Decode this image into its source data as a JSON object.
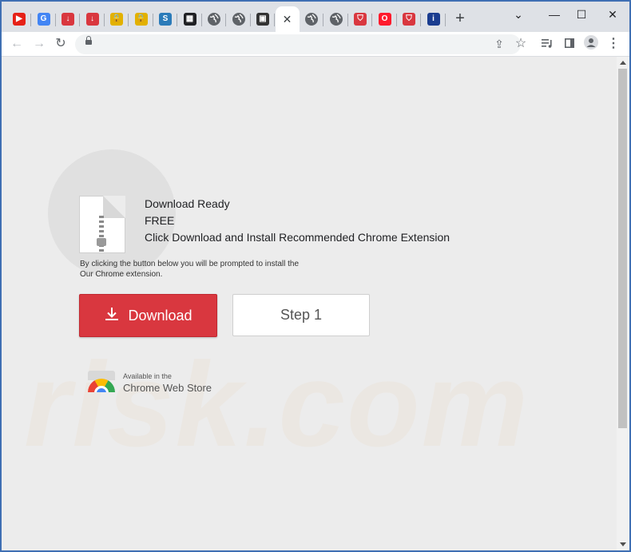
{
  "tabs": [
    {
      "icon": "youtube-icon",
      "glyph": "▶",
      "color": "#e62117"
    },
    {
      "icon": "google-icon",
      "glyph": "G",
      "color": "#4285f4"
    },
    {
      "icon": "download-arrow-icon",
      "glyph": "↓",
      "color": "#d9373f"
    },
    {
      "icon": "download-arrow-icon",
      "glyph": "↓",
      "color": "#d9373f"
    },
    {
      "icon": "lock-icon",
      "glyph": "🔒",
      "color": "#e2b100"
    },
    {
      "icon": "lock-icon",
      "glyph": "🔒",
      "color": "#e2b100"
    },
    {
      "icon": "s-logo-icon",
      "glyph": "S",
      "color": "#2b7bb9"
    },
    {
      "icon": "dark-logo-icon",
      "glyph": "▦",
      "color": "#202124"
    },
    {
      "icon": "globe-icon",
      "glyph": "",
      "color": "#5f6368"
    },
    {
      "icon": "globe-icon",
      "glyph": "",
      "color": "#5f6368"
    },
    {
      "icon": "image-icon",
      "glyph": "▣",
      "color": "#333333"
    },
    {
      "icon": "close-icon",
      "glyph": "✕",
      "color": "#3c4043",
      "active": true
    },
    {
      "icon": "globe-icon",
      "glyph": "",
      "color": "#5f6368"
    },
    {
      "icon": "globe-icon",
      "glyph": "",
      "color": "#5f6368"
    },
    {
      "icon": "shield-icon",
      "glyph": "⛉",
      "color": "#d9373f"
    },
    {
      "icon": "opera-icon",
      "glyph": "O",
      "color": "#ff1b2d"
    },
    {
      "icon": "shield-icon",
      "glyph": "⛉",
      "color": "#d9373f"
    },
    {
      "icon": "italic-i-icon",
      "glyph": "i",
      "color": "#1a3c8f"
    }
  ],
  "window": {
    "minimize": "—",
    "maximize": "☐",
    "close": "✕",
    "dropdown": "⌄",
    "new_tab": "+"
  },
  "toolbar": {
    "back": "←",
    "forward": "→",
    "reload": "↻",
    "share": "⇪",
    "star": "☆",
    "menu": "⋮"
  },
  "content": {
    "line1": "Download Ready",
    "line2": "FREE",
    "line3": "Click Download and Install Recommended Chrome Extension",
    "note1": "By clicking the button below you will be prompted to install the",
    "note2": "Our Chrome extension.",
    "download_label": "Download",
    "step_label": "Step 1",
    "cws_small": "Available in the",
    "cws_big": "Chrome Web Store"
  },
  "colors": {
    "accent_red": "#d9373f",
    "tab_strip": "#dee1e6",
    "frame": "#3f6fb3"
  }
}
